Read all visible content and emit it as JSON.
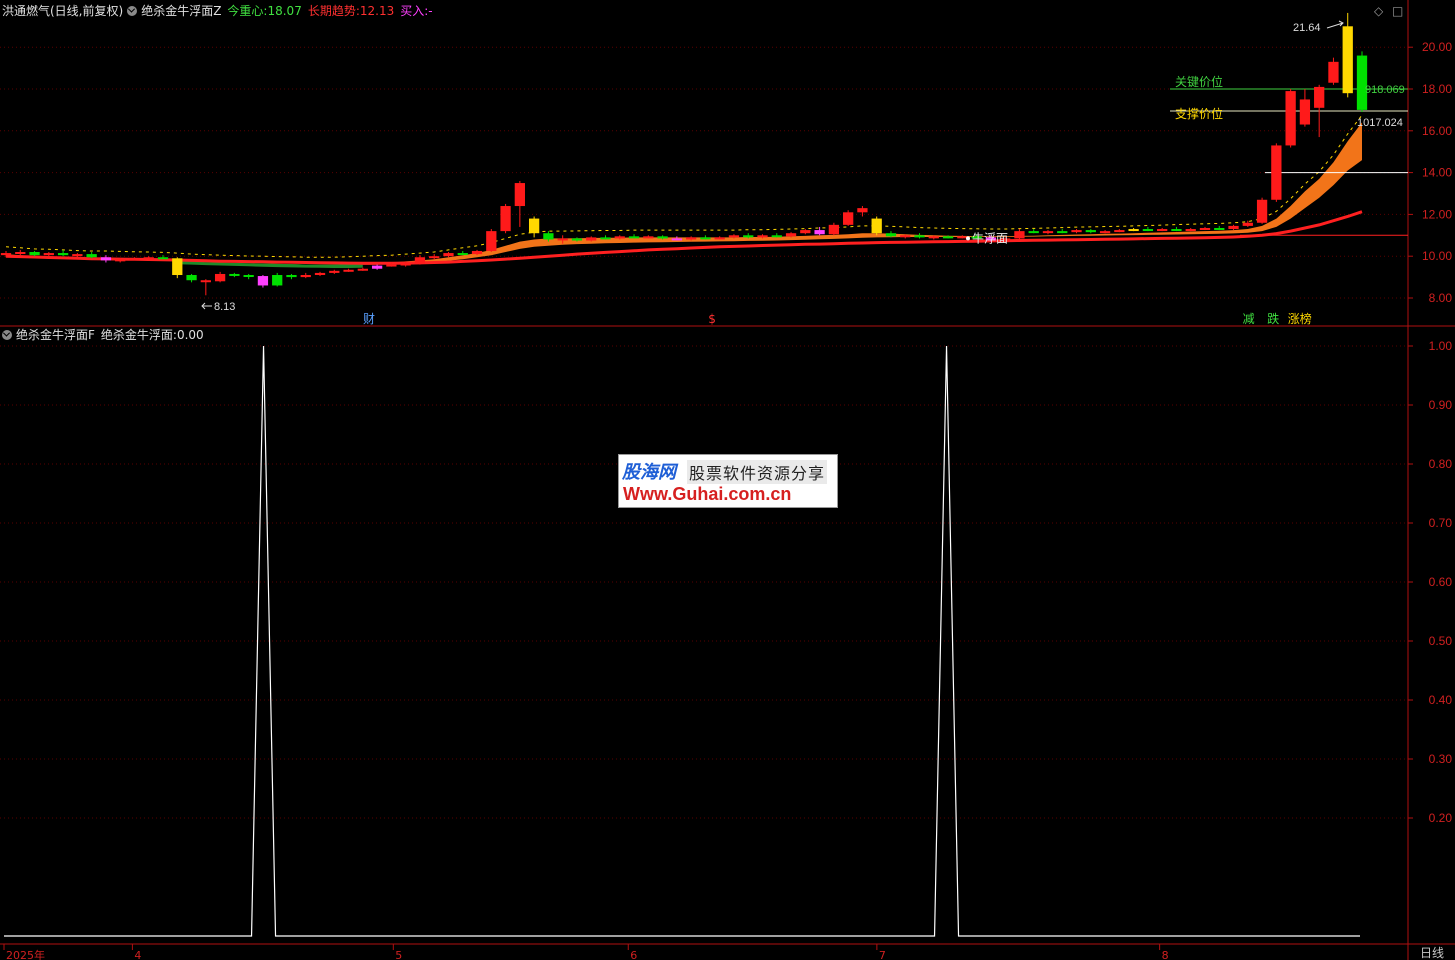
{
  "header": {
    "stock": "洪通燃气(日线,前复权)",
    "indicator_main": "绝杀金牛浮面Z",
    "today_center_label": "今重心:",
    "today_center_value": "18.07",
    "long_trend_label": "长期趋势:",
    "long_trend_value": "12.13",
    "buy_label": "买入:",
    "buy_value": "-"
  },
  "sub_header": {
    "indicator": "绝杀金牛浮面F",
    "value_label": "绝杀金牛浮面:",
    "value": "0.00"
  },
  "controls": {
    "diamond": "◇",
    "box": "□"
  },
  "watermark": {
    "logo": "股海网",
    "tagline": "股票软件资源分享",
    "url": "Www.Guhai.com.cn"
  },
  "colors": {
    "bg": "#000000",
    "axis": "#b01010",
    "up": "#ff1a1a",
    "down": "#00e000",
    "yellow": "#ffd800",
    "magenta": "#ff40ff",
    "orange": "#ff7a1a",
    "trend": "#ff2020",
    "white": "#ffffff",
    "keyline": "#40d040"
  },
  "chart_data": [
    {
      "type": "candlestick",
      "ylim": [
        7.3,
        22.3
      ],
      "y_ticks": [
        "8.00",
        "10.00",
        "12.00",
        "14.00",
        "16.00",
        "18.00",
        "20.00"
      ],
      "annotations": {
        "high_label": "21.64",
        "low_label": "8.13",
        "key_price_label": "关键价位",
        "support_price_label": "支撑价位",
        "key_value_label": "918.069",
        "support_value_label": "1017.024",
        "float_label": "牛浮面",
        "key_price": 18.0,
        "support_price": 16.95,
        "white_level": 14.0,
        "red_level": 11.0
      },
      "markers": [
        {
          "text": "财",
          "color": "#5aa0ff",
          "x": 0.265
        },
        {
          "text": "$",
          "color": "#ff3030",
          "x": 0.517
        },
        {
          "text": "减",
          "color": "#40e040",
          "x": 0.907
        },
        {
          "text": "跌",
          "color": "#40e040",
          "x": 0.925
        },
        {
          "text": "涨榜",
          "color": "#ffd800",
          "x": 0.94
        }
      ],
      "candles": [
        [
          10.05,
          10.25,
          9.95,
          10.15,
          "up"
        ],
        [
          10.15,
          10.3,
          10.05,
          10.2,
          "up"
        ],
        [
          10.2,
          10.25,
          10.0,
          10.05,
          "down"
        ],
        [
          10.05,
          10.2,
          9.95,
          10.15,
          "up"
        ],
        [
          10.15,
          10.3,
          10.0,
          10.05,
          "down"
        ],
        [
          10.05,
          10.15,
          9.95,
          10.1,
          "up"
        ],
        [
          10.1,
          10.2,
          9.9,
          9.95,
          "down"
        ],
        [
          9.95,
          10.05,
          9.7,
          9.8,
          "magenta"
        ],
        [
          9.8,
          9.9,
          9.7,
          9.85,
          "up"
        ],
        [
          9.85,
          9.95,
          9.8,
          9.9,
          "up"
        ],
        [
          9.9,
          10.0,
          9.85,
          9.95,
          "up"
        ],
        [
          9.95,
          10.05,
          9.85,
          9.9,
          "down"
        ],
        [
          9.9,
          9.95,
          8.95,
          9.1,
          "yellow"
        ],
        [
          9.1,
          9.15,
          8.75,
          8.85,
          "down"
        ],
        [
          8.85,
          8.9,
          8.13,
          8.8,
          "up"
        ],
        [
          8.8,
          9.25,
          8.75,
          9.15,
          "up"
        ],
        [
          9.15,
          9.2,
          9.0,
          9.1,
          "down"
        ],
        [
          9.1,
          9.15,
          8.9,
          9.05,
          "down"
        ],
        [
          9.05,
          9.1,
          8.5,
          8.6,
          "magenta"
        ],
        [
          8.6,
          9.2,
          8.55,
          9.1,
          "down"
        ],
        [
          9.1,
          9.15,
          8.9,
          9.0,
          "down"
        ],
        [
          9.0,
          9.2,
          8.95,
          9.1,
          "up"
        ],
        [
          9.1,
          9.25,
          9.05,
          9.2,
          "up"
        ],
        [
          9.2,
          9.35,
          9.15,
          9.3,
          "up"
        ],
        [
          9.3,
          9.4,
          9.25,
          9.35,
          "up"
        ],
        [
          9.35,
          9.45,
          9.3,
          9.4,
          "up"
        ],
        [
          9.4,
          9.6,
          9.35,
          9.55,
          "magenta"
        ],
        [
          9.55,
          9.7,
          9.5,
          9.6,
          "up"
        ],
        [
          9.6,
          9.75,
          9.5,
          9.65,
          "up"
        ],
        [
          9.65,
          10.05,
          9.6,
          9.95,
          "up"
        ],
        [
          9.95,
          10.1,
          9.85,
          10.0,
          "up"
        ],
        [
          10.0,
          10.2,
          9.95,
          10.15,
          "up"
        ],
        [
          10.15,
          10.25,
          10.05,
          10.1,
          "down"
        ],
        [
          10.1,
          10.3,
          10.05,
          10.25,
          "up"
        ],
        [
          10.25,
          11.3,
          10.2,
          11.2,
          "up"
        ],
        [
          11.2,
          12.5,
          11.1,
          12.4,
          "up"
        ],
        [
          12.4,
          13.6,
          11.4,
          13.5,
          "up"
        ],
        [
          11.8,
          11.9,
          10.9,
          11.1,
          "yellow"
        ],
        [
          11.1,
          11.2,
          10.7,
          10.8,
          "down"
        ],
        [
          10.8,
          11.0,
          10.6,
          10.85,
          "up"
        ],
        [
          10.85,
          10.9,
          10.7,
          10.75,
          "down"
        ],
        [
          10.75,
          10.95,
          10.7,
          10.9,
          "up"
        ],
        [
          10.9,
          11.0,
          10.8,
          10.85,
          "down"
        ],
        [
          10.85,
          11.0,
          10.8,
          10.95,
          "up"
        ],
        [
          10.95,
          11.05,
          10.85,
          10.9,
          "down"
        ],
        [
          10.9,
          11.0,
          10.85,
          10.95,
          "up"
        ],
        [
          10.95,
          11.0,
          10.8,
          10.85,
          "down"
        ],
        [
          10.85,
          10.95,
          10.75,
          10.8,
          "magenta"
        ],
        [
          10.8,
          10.95,
          10.75,
          10.9,
          "up"
        ],
        [
          10.9,
          11.0,
          10.8,
          10.85,
          "down"
        ],
        [
          10.85,
          10.95,
          10.8,
          10.9,
          "up"
        ],
        [
          10.9,
          11.05,
          10.85,
          11.0,
          "up"
        ],
        [
          11.0,
          11.1,
          10.85,
          10.9,
          "down"
        ],
        [
          10.9,
          11.05,
          10.85,
          11.0,
          "up"
        ],
        [
          11.0,
          11.1,
          10.9,
          10.95,
          "down"
        ],
        [
          10.95,
          11.15,
          10.9,
          11.1,
          "up"
        ],
        [
          11.1,
          11.3,
          11.05,
          11.25,
          "up"
        ],
        [
          11.25,
          11.4,
          11.0,
          11.05,
          "magenta"
        ],
        [
          11.05,
          11.6,
          11.0,
          11.5,
          "up"
        ],
        [
          11.5,
          12.2,
          11.45,
          12.1,
          "up"
        ],
        [
          12.1,
          12.4,
          11.9,
          12.3,
          "up"
        ],
        [
          11.8,
          11.9,
          11.0,
          11.1,
          "yellow"
        ],
        [
          11.1,
          11.2,
          10.9,
          10.95,
          "down"
        ],
        [
          10.95,
          11.05,
          10.85,
          11.0,
          "up"
        ],
        [
          11.0,
          11.1,
          10.85,
          10.9,
          "down"
        ],
        [
          10.9,
          11.0,
          10.8,
          10.95,
          "up"
        ],
        [
          10.95,
          11.0,
          10.85,
          10.9,
          "down"
        ],
        [
          10.9,
          11.0,
          10.85,
          10.95,
          "up"
        ],
        [
          10.95,
          11.05,
          10.85,
          10.9,
          "down"
        ],
        [
          10.9,
          11.0,
          10.7,
          10.75,
          "magenta"
        ],
        [
          10.75,
          10.9,
          10.7,
          10.85,
          "up"
        ],
        [
          10.85,
          11.3,
          10.8,
          11.2,
          "up"
        ],
        [
          11.2,
          11.3,
          11.1,
          11.15,
          "down"
        ],
        [
          11.15,
          11.25,
          11.05,
          11.2,
          "up"
        ],
        [
          11.2,
          11.3,
          11.1,
          11.15,
          "down"
        ],
        [
          11.15,
          11.3,
          11.1,
          11.25,
          "up"
        ],
        [
          11.25,
          11.3,
          11.1,
          11.15,
          "down"
        ],
        [
          11.15,
          11.25,
          11.1,
          11.2,
          "up"
        ],
        [
          11.2,
          11.3,
          11.15,
          11.25,
          "up"
        ],
        [
          11.25,
          11.35,
          11.2,
          11.3,
          "yellow"
        ],
        [
          11.3,
          11.4,
          11.2,
          11.25,
          "down"
        ],
        [
          11.25,
          11.35,
          11.2,
          11.3,
          "up"
        ],
        [
          11.3,
          11.4,
          11.2,
          11.25,
          "down"
        ],
        [
          11.25,
          11.35,
          11.2,
          11.3,
          "up"
        ],
        [
          11.3,
          11.4,
          11.25,
          11.35,
          "up"
        ],
        [
          11.35,
          11.45,
          11.25,
          11.3,
          "down"
        ],
        [
          11.3,
          11.5,
          11.25,
          11.45,
          "up"
        ],
        [
          11.45,
          11.7,
          11.4,
          11.6,
          "up"
        ],
        [
          11.6,
          12.8,
          11.55,
          12.7,
          "up"
        ],
        [
          12.7,
          15.4,
          12.6,
          15.3,
          "up"
        ],
        [
          15.3,
          18.0,
          15.2,
          17.9,
          "up"
        ],
        [
          16.3,
          18.0,
          16.2,
          17.5,
          "up"
        ],
        [
          17.1,
          18.2,
          15.7,
          18.1,
          "up"
        ],
        [
          18.3,
          19.5,
          18.2,
          19.3,
          "up"
        ],
        [
          17.8,
          21.64,
          17.6,
          21.0,
          "yellow"
        ],
        [
          17.0,
          19.8,
          16.9,
          19.6,
          "down"
        ]
      ],
      "main_fast": [
        10.1,
        10.05,
        10.0,
        9.98,
        9.95,
        9.92,
        9.9,
        9.9,
        9.88,
        9.86,
        9.85,
        9.83,
        9.8,
        9.75,
        9.72,
        9.7,
        9.68,
        9.66,
        9.65,
        9.63,
        9.62,
        9.6,
        9.6,
        9.6,
        9.62,
        9.65,
        9.68,
        9.7,
        9.75,
        9.8,
        9.85,
        9.95,
        10.05,
        10.15,
        10.3,
        10.5,
        10.7,
        10.8,
        10.85,
        10.85,
        10.86,
        10.87,
        10.88,
        10.88,
        10.9,
        10.9,
        10.9,
        10.9,
        10.9,
        10.9,
        10.9,
        10.9,
        10.92,
        10.92,
        10.93,
        10.95,
        10.97,
        11.0,
        11.02,
        11.05,
        11.1,
        11.1,
        11.08,
        11.05,
        11.02,
        11.0,
        10.98,
        10.97,
        10.96,
        10.95,
        10.95,
        10.97,
        10.98,
        11.0,
        11.02,
        11.04,
        11.05,
        11.07,
        11.08,
        11.1,
        11.12,
        11.14,
        11.16,
        11.18,
        11.2,
        11.22,
        11.25,
        11.3,
        11.45,
        11.8,
        12.4,
        13.1,
        13.7,
        14.5,
        15.5,
        16.4
      ],
      "main_slow": [
        10.0,
        9.98,
        9.96,
        9.94,
        9.92,
        9.9,
        9.88,
        9.86,
        9.84,
        9.82,
        9.8,
        9.78,
        9.76,
        9.74,
        9.72,
        9.7,
        9.68,
        9.66,
        9.64,
        9.62,
        9.61,
        9.6,
        9.59,
        9.58,
        9.58,
        9.59,
        9.6,
        9.62,
        9.65,
        9.68,
        9.72,
        9.78,
        9.85,
        9.95,
        10.05,
        10.2,
        10.35,
        10.45,
        10.5,
        10.55,
        10.58,
        10.6,
        10.62,
        10.63,
        10.65,
        10.66,
        10.67,
        10.68,
        10.69,
        10.7,
        10.71,
        10.72,
        10.73,
        10.74,
        10.75,
        10.77,
        10.79,
        10.81,
        10.83,
        10.85,
        10.88,
        10.9,
        10.91,
        10.92,
        10.92,
        10.92,
        10.92,
        10.92,
        10.92,
        10.92,
        10.92,
        10.93,
        10.94,
        10.95,
        10.96,
        10.97,
        10.98,
        10.99,
        11.0,
        11.01,
        11.02,
        11.03,
        11.04,
        11.05,
        11.06,
        11.07,
        11.09,
        11.12,
        11.2,
        11.4,
        11.8,
        12.3,
        12.8,
        13.4,
        14.1,
        14.6
      ],
      "trend": [
        10.0,
        9.98,
        9.96,
        9.94,
        9.92,
        9.9,
        9.88,
        9.87,
        9.86,
        9.85,
        9.84,
        9.83,
        9.82,
        9.8,
        9.78,
        9.76,
        9.75,
        9.74,
        9.73,
        9.72,
        9.71,
        9.7,
        9.69,
        9.68,
        9.67,
        9.66,
        9.66,
        9.66,
        9.67,
        9.68,
        9.7,
        9.72,
        9.75,
        9.78,
        9.82,
        9.86,
        9.9,
        9.95,
        10.0,
        10.05,
        10.1,
        10.14,
        10.18,
        10.22,
        10.26,
        10.3,
        10.33,
        10.36,
        10.39,
        10.42,
        10.45,
        10.47,
        10.49,
        10.51,
        10.53,
        10.55,
        10.57,
        10.58,
        10.6,
        10.62,
        10.63,
        10.65,
        10.66,
        10.67,
        10.68,
        10.69,
        10.7,
        10.71,
        10.72,
        10.73,
        10.74,
        10.75,
        10.76,
        10.77,
        10.78,
        10.79,
        10.8,
        10.81,
        10.82,
        10.83,
        10.84,
        10.85,
        10.86,
        10.87,
        10.88,
        10.9,
        10.92,
        10.95,
        11.0,
        11.08,
        11.2,
        11.35,
        11.5,
        11.7,
        11.9,
        12.13
      ],
      "green_band": [
        false,
        false,
        false,
        false,
        false,
        false,
        false,
        false,
        false,
        false,
        false,
        false,
        true,
        true,
        true,
        true,
        true,
        true,
        true,
        true,
        true,
        true,
        true,
        true,
        true,
        true,
        false,
        false,
        false,
        false,
        false,
        false,
        false,
        false,
        false,
        false,
        false,
        false,
        false,
        false,
        false,
        false,
        false,
        false,
        false,
        false,
        false,
        false,
        false,
        false,
        false,
        false,
        false,
        false,
        false,
        false,
        false,
        false,
        false,
        false,
        false,
        false,
        false,
        false,
        false,
        false,
        false,
        false,
        false,
        false,
        false,
        false,
        false,
        false,
        false,
        false,
        false,
        false,
        false,
        false,
        false,
        false,
        false,
        false,
        false,
        false,
        false,
        false,
        false,
        false,
        false,
        false,
        false,
        false,
        false,
        false
      ]
    },
    {
      "type": "line",
      "ylim": [
        0,
        1.03
      ],
      "y_ticks": [
        "0.20",
        "0.30",
        "0.40",
        "0.50",
        "0.60",
        "0.70",
        "0.80",
        "0.90",
        "1.00"
      ],
      "series": [
        {
          "name": "绝杀金牛浮面",
          "spikes_at": [
            0.19,
            0.69
          ],
          "values_at_spikes": [
            1.0,
            1.0
          ]
        }
      ],
      "x_ticks": [
        {
          "label": "2025年",
          "x": 0.0
        },
        {
          "label": "4",
          "x": 0.094
        },
        {
          "label": "5",
          "x": 0.285
        },
        {
          "label": "6",
          "x": 0.457
        },
        {
          "label": "7",
          "x": 0.639
        },
        {
          "label": "8",
          "x": 0.846
        }
      ],
      "period_label": "日线"
    }
  ]
}
